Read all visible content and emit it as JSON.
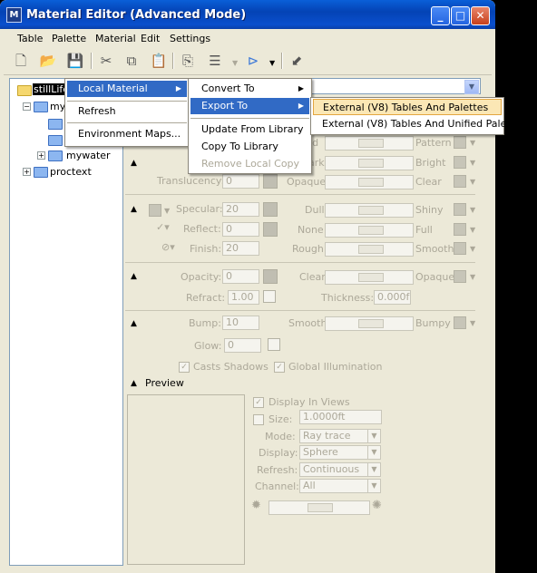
{
  "window": {
    "title": "Material Editor (Advanced Mode)",
    "app_icon_glyph": "M"
  },
  "menubar": [
    "Table",
    "Palette",
    "Material",
    "Edit",
    "Settings"
  ],
  "tree": {
    "items": [
      {
        "label": "stillLife"
      },
      {
        "label": "myp"
      },
      {
        "label": "mywater"
      },
      {
        "label": "proctext"
      }
    ]
  },
  "context_menu": {
    "items": [
      {
        "label": "Local Material",
        "has_submenu": true,
        "highlighted": true
      },
      {
        "label": "Refresh"
      },
      {
        "label": "Environment Maps..."
      }
    ]
  },
  "submenu": {
    "items": [
      {
        "label": "Convert To",
        "has_submenu": true
      },
      {
        "label": "Export To",
        "has_submenu": true,
        "highlighted": true
      },
      {
        "label": "Update From Library"
      },
      {
        "label": "Copy To Library"
      },
      {
        "label": "Remove Local Copy",
        "disabled": true
      }
    ]
  },
  "export_submenu": {
    "items": [
      {
        "label": "External (V8) Tables And Palettes",
        "highlighted": true
      },
      {
        "label": "External (V8) Tables And Unified Palette"
      }
    ]
  },
  "props": {
    "row1": {
      "left_partial": "lid",
      "right": "Pattern"
    },
    "row2": {
      "left_partial": "ark",
      "right": "Bright"
    },
    "translucency": {
      "label": "Translucency:",
      "value": "0",
      "left": "Opaque",
      "right": "Clear"
    },
    "specular": {
      "label": "Specular:",
      "value": "20",
      "left": "Dull",
      "right": "Shiny"
    },
    "reflect": {
      "label": "Reflect:",
      "value": "0",
      "left": "None",
      "right": "Full"
    },
    "finish": {
      "label": "Finish:",
      "value": "20",
      "left": "Rough",
      "right": "Smooth"
    },
    "opacity": {
      "label": "Opacity:",
      "value": "0",
      "left": "Clear",
      "right": "Opaque"
    },
    "refract": {
      "label": "Refract:",
      "value": "1.00"
    },
    "thickness": {
      "label": "Thickness:",
      "value": "0.000f"
    },
    "bump": {
      "label": "Bump:",
      "value": "10",
      "left": "Smooth",
      "right": "Bumpy"
    },
    "glow": {
      "label": "Glow:",
      "value": "0"
    },
    "casts_shadows": "Casts Shadows",
    "global_illumination": "Global Illumination"
  },
  "preview": {
    "header": "Preview",
    "display_in_views": "Display In Views",
    "size_label": "Size:",
    "size_value": "1.0000ft",
    "mode_label": "Mode:",
    "mode_value": "Ray trace",
    "display_label": "Display:",
    "display_value": "Sphere",
    "refresh_label": "Refresh:",
    "refresh_value": "Continuous",
    "channel_label": "Channel:",
    "channel_value": "All"
  }
}
